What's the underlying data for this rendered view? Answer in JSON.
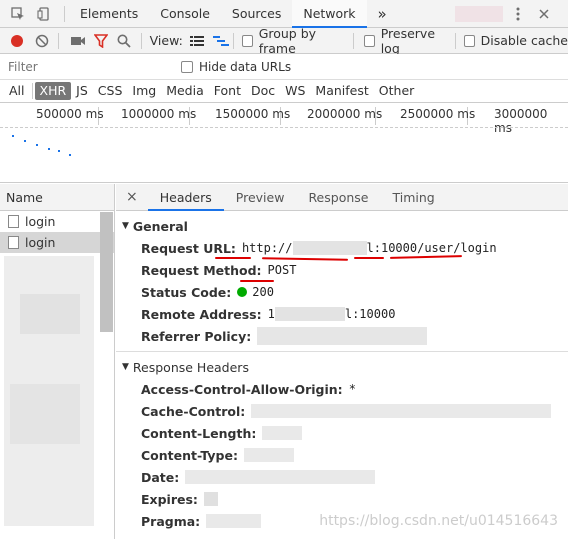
{
  "devtools": {
    "tabs": [
      "Elements",
      "Console",
      "Sources",
      "Network"
    ],
    "more": "»"
  },
  "toolbar": {
    "view_label": "View:",
    "group_by_frame": "Group by frame",
    "preserve_log": "Preserve log",
    "disable_cache": "Disable cache"
  },
  "filter": {
    "placeholder": "Filter",
    "hide_data_urls": "Hide data URLs"
  },
  "types": [
    "All",
    "XHR",
    "JS",
    "CSS",
    "Img",
    "Media",
    "Font",
    "Doc",
    "WS",
    "Manifest",
    "Other"
  ],
  "timeline": {
    "ticks": [
      "500000 ms",
      "1000000 ms",
      "1500000 ms",
      "2000000 ms",
      "2500000 ms",
      "3000000 ms"
    ]
  },
  "requests": {
    "header": "Name",
    "items": [
      "login",
      "login"
    ]
  },
  "details": {
    "close": "×",
    "tabs": [
      "Headers",
      "Preview",
      "Response",
      "Timing"
    ],
    "general": {
      "title": "General",
      "request_url_key": "Request URL:",
      "request_url_scheme": "http://",
      "request_url_rest": "l:10000/user/login",
      "request_method_key": "Request Method:",
      "request_method_val": "POST",
      "status_code_key": "Status Code:",
      "status_code_val": "200",
      "remote_address_key": "Remote Address:",
      "remote_address_prefix": "1",
      "remote_address_rest": "l:10000",
      "referrer_policy_key": "Referrer Policy:"
    },
    "response_headers": {
      "title": "Response Headers",
      "acao_key": "Access-Control-Allow-Origin:",
      "acao_val": "*",
      "cache_control_key": "Cache-Control:",
      "content_length_key": "Content-Length:",
      "content_type_key": "Content-Type:",
      "date_key": "Date:",
      "expires_key": "Expires:",
      "pragma_key": "Pragma:"
    }
  },
  "watermark": "https://blog.csdn.net/u014516643",
  "colors": {
    "accent": "#1a73e8",
    "record": "#d93025",
    "annotation": "#dd0000"
  }
}
